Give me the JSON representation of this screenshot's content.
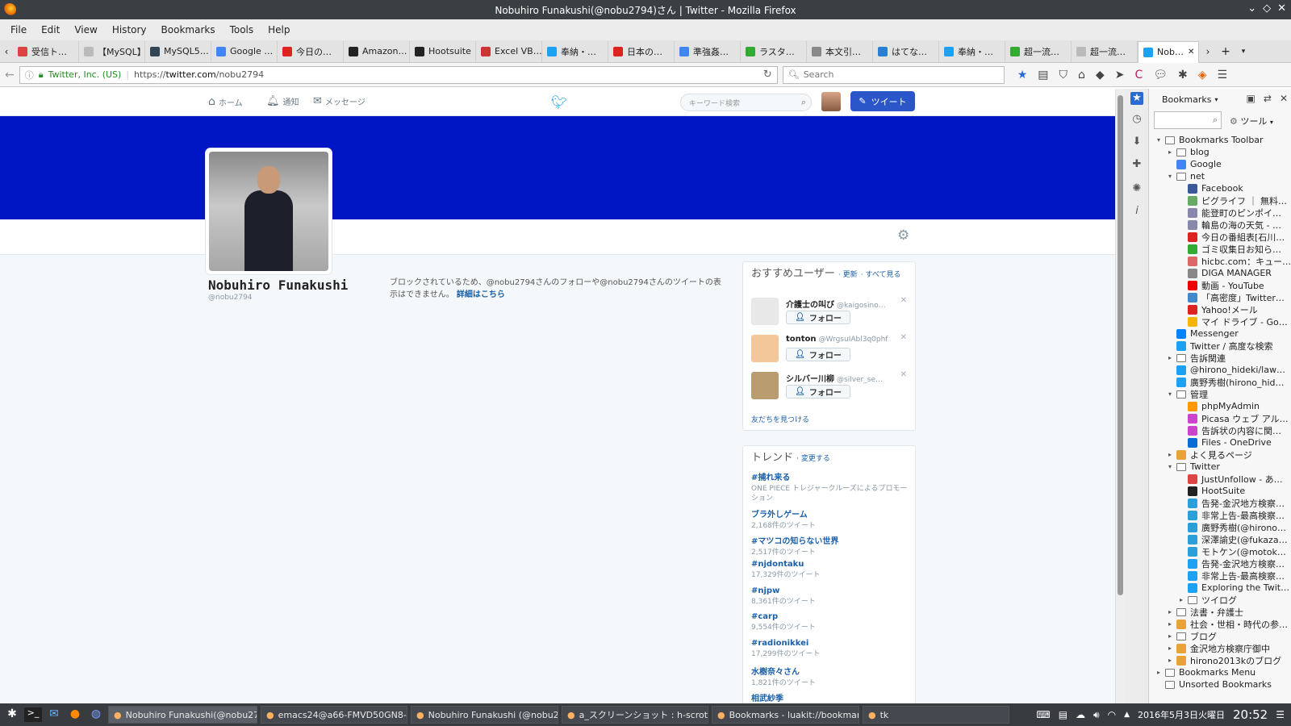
{
  "window": {
    "title": "Nobuhiro Funakushi(@nobu2794)さん | Twitter - Mozilla Firefox"
  },
  "menu": [
    "File",
    "Edit",
    "View",
    "History",
    "Bookmarks",
    "Tools",
    "Help"
  ],
  "tabs": [
    {
      "label": "受信ト…",
      "color": "#d44"
    },
    {
      "label": "【MySQL】…",
      "color": "#bbb"
    },
    {
      "label": "MySQL5…",
      "color": "#345"
    },
    {
      "label": "Google …",
      "color": "#4285f4"
    },
    {
      "label": "今日の…",
      "color": "#d22"
    },
    {
      "label": "Amazon…",
      "color": "#222"
    },
    {
      "label": "Hootsuite",
      "color": "#222"
    },
    {
      "label": "Excel VB…",
      "color": "#c33"
    },
    {
      "label": "奉納・…",
      "color": "#1da1f2"
    },
    {
      "label": "日本の…",
      "color": "#d22"
    },
    {
      "label": "準強姦…",
      "color": "#4285f4"
    },
    {
      "label": "ラスタ…",
      "color": "#3a3"
    },
    {
      "label": "本文引…",
      "color": "#888"
    },
    {
      "label": "はてな…",
      "color": "#2a7fd4"
    },
    {
      "label": "奉納・…",
      "color": "#1da1f2"
    },
    {
      "label": "超一流…",
      "color": "#3a3"
    },
    {
      "label": "超一流…",
      "color": "#bbb"
    },
    {
      "label": "Nob…",
      "color": "#1da1f2"
    }
  ],
  "nav": {
    "identity": "Twitter, Inc. (US)",
    "url_prefix": "https://",
    "url_host": "twitter.com",
    "url_path": "/nobu2794",
    "search_placeholder": "Search"
  },
  "twitter": {
    "nav_home": "ホーム",
    "nav_notifications": "通知",
    "nav_messages": "メッセージ",
    "search_placeholder": "キーワード検索",
    "tweet_button": "ツイート",
    "profile_name": "Nobuhiro Funakushi",
    "profile_handle": "@nobu2794",
    "blocked_text": "ブロックされているため、@nobu2794さんのフォローや@nobu2794さんのツイートの表示はできません。",
    "blocked_link": "詳細はこちら",
    "wtf": {
      "title": "おすすめユーザー",
      "refresh": "更新",
      "view_all": "すべて見る",
      "find_friends": "友だちを見つける",
      "follow_label": "フォロー",
      "users": [
        {
          "name": "介護士の叫び",
          "handle": "@kaigosino…",
          "avatar_color": "#e8e8e8"
        },
        {
          "name": "tonton",
          "handle": "@WrgsuIAbl3q0phf",
          "avatar_color": "#f3c79a"
        },
        {
          "name": "シルバー川柳",
          "handle": "@silver_se…",
          "avatar_color": "#b99c6f"
        }
      ]
    },
    "trends": {
      "title": "トレンド",
      "change": "変更する",
      "items": [
        {
          "name": "#捕れ来る",
          "meta": "ONE PIECE トレジャークルーズによるプロモーション"
        },
        {
          "name": "ブラ外しゲーム",
          "meta": "2,168件のツイート"
        },
        {
          "name": "#マツコの知らない世界",
          "meta": "2,517件のツイート"
        },
        {
          "name": "#njdontaku",
          "meta": "17,329件のツイート"
        },
        {
          "name": "#njpw",
          "meta": "8,361件のツイート"
        },
        {
          "name": "#carp",
          "meta": "9,554件のツイート"
        },
        {
          "name": "#radionikkei",
          "meta": "17,299件のツイート"
        },
        {
          "name": "水樹奈々さん",
          "meta": "1,821件のツイート"
        },
        {
          "name": "相武紗季",
          "meta": ""
        }
      ]
    }
  },
  "sidebar": {
    "title": "Bookmarks",
    "tools_label": "ツール",
    "tree": [
      {
        "label": "Bookmarks Toolbar",
        "depth": 0,
        "arrow": "▾",
        "kind": "folder"
      },
      {
        "label": "blog",
        "depth": 1,
        "arrow": "▸",
        "kind": "folder"
      },
      {
        "label": "Google",
        "depth": 1,
        "arrow": "",
        "kind": "icon",
        "color": "#4285f4"
      },
      {
        "label": "net",
        "depth": 1,
        "arrow": "▾",
        "kind": "folder"
      },
      {
        "label": "Facebook",
        "depth": 2,
        "arrow": "",
        "kind": "icon",
        "color": "#3b5998"
      },
      {
        "label": "ピグライフ ｜ 無料…",
        "depth": 2,
        "arrow": "",
        "kind": "icon",
        "color": "#6a6"
      },
      {
        "label": "能登町のピンポイ…",
        "depth": 2,
        "arrow": "",
        "kind": "icon",
        "color": "#88a"
      },
      {
        "label": "輪島の海の天気 - …",
        "depth": 2,
        "arrow": "",
        "kind": "icon",
        "color": "#88a"
      },
      {
        "label": "今日の番組表[石川…",
        "depth": 2,
        "arrow": "",
        "kind": "icon",
        "color": "#d22"
      },
      {
        "label": "ゴミ収集日お知ら…",
        "depth": 2,
        "arrow": "",
        "kind": "icon",
        "color": "#3a3"
      },
      {
        "label": "hicbc.com：キュー…",
        "depth": 2,
        "arrow": "",
        "kind": "icon",
        "color": "#d66"
      },
      {
        "label": "DIGA MANAGER",
        "depth": 2,
        "arrow": "",
        "kind": "icon",
        "color": "#888"
      },
      {
        "label": "動画 - YouTube",
        "depth": 2,
        "arrow": "",
        "kind": "icon",
        "color": "#e00"
      },
      {
        "label": "「高密度」Twitter…",
        "depth": 2,
        "arrow": "",
        "kind": "icon",
        "color": "#48c"
      },
      {
        "label": "Yahoo!メール",
        "depth": 2,
        "arrow": "",
        "kind": "icon",
        "color": "#d22"
      },
      {
        "label": "マイ ドライブ - Go…",
        "depth": 2,
        "arrow": "",
        "kind": "icon",
        "color": "#f4b400"
      },
      {
        "label": "Messenger",
        "depth": 1,
        "arrow": "",
        "kind": "icon",
        "color": "#0084ff"
      },
      {
        "label": "Twitter / 高度な検索",
        "depth": 1,
        "arrow": "",
        "kind": "icon",
        "color": "#1da1f2"
      },
      {
        "label": "告訴関連",
        "depth": 1,
        "arrow": "▸",
        "kind": "folder"
      },
      {
        "label": "@hirono_hideki/law…",
        "depth": 1,
        "arrow": "",
        "kind": "icon",
        "color": "#1da1f2"
      },
      {
        "label": "廣野秀樹(hirono_hid…",
        "depth": 1,
        "arrow": "",
        "kind": "icon",
        "color": "#1da1f2"
      },
      {
        "label": "管理",
        "depth": 1,
        "arrow": "▾",
        "kind": "folder"
      },
      {
        "label": "phpMyAdmin",
        "depth": 2,
        "arrow": "",
        "kind": "icon",
        "color": "#f90"
      },
      {
        "label": "Picasa ウェブ アル…",
        "depth": 2,
        "arrow": "",
        "kind": "icon",
        "color": "#c4c"
      },
      {
        "label": "告訴状の内容に関…",
        "depth": 2,
        "arrow": "",
        "kind": "icon",
        "color": "#c4c"
      },
      {
        "label": "Files - OneDrive",
        "depth": 2,
        "arrow": "",
        "kind": "icon",
        "color": "#0a6cd4"
      },
      {
        "label": "よく見るページ",
        "depth": 1,
        "arrow": "▸",
        "kind": "icon",
        "color": "#e8a23a"
      },
      {
        "label": "Twitter",
        "depth": 1,
        "arrow": "▾",
        "kind": "folder"
      },
      {
        "label": "JustUnfollow - あ…",
        "depth": 2,
        "arrow": "",
        "kind": "icon",
        "color": "#d44"
      },
      {
        "label": "HootSuite",
        "depth": 2,
        "arrow": "",
        "kind": "icon",
        "color": "#222"
      },
      {
        "label": "告発-金沢地方検察…",
        "depth": 2,
        "arrow": "",
        "kind": "icon",
        "color": "#2b9fd9"
      },
      {
        "label": "非常上告-最高検察…",
        "depth": 2,
        "arrow": "",
        "kind": "icon",
        "color": "#2b9fd9"
      },
      {
        "label": "廣野秀樹(@hirono…",
        "depth": 2,
        "arrow": "",
        "kind": "icon",
        "color": "#2b9fd9"
      },
      {
        "label": "深澤諭史(@fukaza…",
        "depth": 2,
        "arrow": "",
        "kind": "icon",
        "color": "#2b9fd9"
      },
      {
        "label": "モトケン(@motok…",
        "depth": 2,
        "arrow": "",
        "kind": "icon",
        "color": "#2b9fd9"
      },
      {
        "label": "告発-金沢地方検察…",
        "depth": 2,
        "arrow": "",
        "kind": "icon",
        "color": "#1da1f2"
      },
      {
        "label": "非常上告-最高検察…",
        "depth": 2,
        "arrow": "",
        "kind": "icon",
        "color": "#1da1f2"
      },
      {
        "label": "Exploring the Twit…",
        "depth": 2,
        "arrow": "",
        "kind": "icon",
        "color": "#1da1f2"
      },
      {
        "label": "ツイログ",
        "depth": 2,
        "arrow": "▸",
        "kind": "folder"
      },
      {
        "label": "法書・弁護士",
        "depth": 1,
        "arrow": "▸",
        "kind": "folder"
      },
      {
        "label": "社会・世相・時代の参…",
        "depth": 1,
        "arrow": "▸",
        "kind": "icon",
        "color": "#e8a23a"
      },
      {
        "label": "ブログ",
        "depth": 1,
        "arrow": "▸",
        "kind": "folder"
      },
      {
        "label": "金沢地方検察庁御中",
        "depth": 1,
        "arrow": "▸",
        "kind": "icon",
        "color": "#e8a23a"
      },
      {
        "label": "hirono2013kのブログ",
        "depth": 1,
        "arrow": "▸",
        "kind": "icon",
        "color": "#e8a23a"
      },
      {
        "label": "Bookmarks Menu",
        "depth": 0,
        "arrow": "▸",
        "kind": "folder"
      },
      {
        "label": "Unsorted Bookmarks",
        "depth": 0,
        "arrow": "",
        "kind": "folder"
      }
    ]
  },
  "taskbar": {
    "items": [
      {
        "label": "Nobuhiro Funakushi(@nobu27…",
        "active": true
      },
      {
        "label": "emacs24@a66-FMVD50GN8-g",
        "active": false
      },
      {
        "label": "Nobuhiro Funakushi (@nobu27…",
        "active": false
      },
      {
        "label": "a_スクリーンショット : h-scrot-esc.r…",
        "active": false
      },
      {
        "label": "Bookmarks - luakit://bookmark…",
        "active": false
      },
      {
        "label": "tk",
        "active": false
      }
    ],
    "date": "2016年5月3日火曜日",
    "time": "20:52"
  }
}
